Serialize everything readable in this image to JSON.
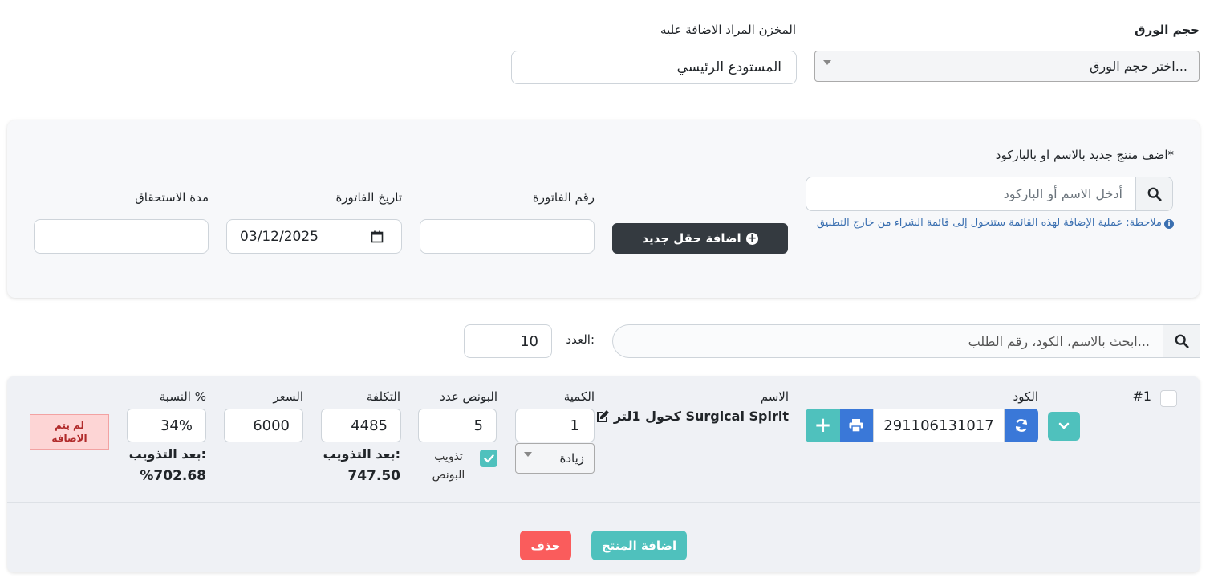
{
  "top": {
    "paper_size_label": "حجم الورق",
    "paper_size_placeholder": "اختر حجم الورق...",
    "warehouse_label": "المخزن المراد الاضافة عليه",
    "warehouse_value": "المستودع الرئيسي"
  },
  "add_panel": {
    "product_label": "اضف منتج جديد بالاسم او بالباركود*",
    "product_search_placeholder": "أدخل الاسم أو الباركود",
    "note": "ملاحظة: عملية الإضافة لهذه القائمة ستتحول إلى قائمة الشراء من خارج التطبيق",
    "add_field_button": "اضافة حقل جديد",
    "invoice_number_label": "رقم الفاتورة",
    "invoice_number_value": "",
    "invoice_date_label": "تاريخ الفاتورة",
    "invoice_date_value": "03/12/2025",
    "due_period_label": "مدة الاستحقاق",
    "due_period_value": ""
  },
  "filter": {
    "search_placeholder": "ابحث بالاسم، الكود، رقم الطلب...",
    "count_label": "العدد:",
    "count_value": "10"
  },
  "item": {
    "index": "#1",
    "code_label": "الكود",
    "code_value": "291106131017",
    "name_label": "الاسم",
    "name_value": "Surgical Spirit كحول 1لتر",
    "qty_label": "الكمية",
    "qty_value": "1",
    "qty_mode": "زيادة",
    "bonus_label": "البونص عدد",
    "bonus_value": "5",
    "bonus_dist_label": "تذويب البونص",
    "bonus_dist_checked": true,
    "cost_label": "التكلفة",
    "cost_value": "4485",
    "cost_after_label": "بعد التذويب:",
    "cost_after_value": "747.50",
    "price_label": "السعر",
    "price_value": "6000",
    "pct_label": "النسبة %",
    "pct_value": "34%",
    "pct_after_label": "بعد التذويب:",
    "pct_after_value": "%702.68",
    "status_badge": "لم يتم الاضافة"
  },
  "actions": {
    "add_product": "اضافة المنتج",
    "delete": "حذف"
  },
  "colors": {
    "teal": "#4fc1bd",
    "blue": "#3a78d8",
    "dark": "#343a40",
    "red": "#fa5c5c",
    "badge_bg": "#fdd5d5",
    "badge_text": "#b02a2a",
    "link": "#3a6fb0"
  }
}
